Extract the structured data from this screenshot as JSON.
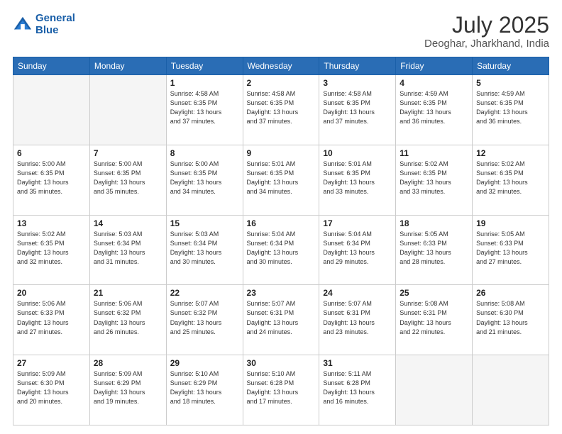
{
  "header": {
    "logo_line1": "General",
    "logo_line2": "Blue",
    "title": "July 2025",
    "subtitle": "Deoghar, Jharkhand, India"
  },
  "columns": [
    "Sunday",
    "Monday",
    "Tuesday",
    "Wednesday",
    "Thursday",
    "Friday",
    "Saturday"
  ],
  "weeks": [
    [
      {
        "day": "",
        "info": ""
      },
      {
        "day": "",
        "info": ""
      },
      {
        "day": "1",
        "info": "Sunrise: 4:58 AM\nSunset: 6:35 PM\nDaylight: 13 hours\nand 37 minutes."
      },
      {
        "day": "2",
        "info": "Sunrise: 4:58 AM\nSunset: 6:35 PM\nDaylight: 13 hours\nand 37 minutes."
      },
      {
        "day": "3",
        "info": "Sunrise: 4:58 AM\nSunset: 6:35 PM\nDaylight: 13 hours\nand 37 minutes."
      },
      {
        "day": "4",
        "info": "Sunrise: 4:59 AM\nSunset: 6:35 PM\nDaylight: 13 hours\nand 36 minutes."
      },
      {
        "day": "5",
        "info": "Sunrise: 4:59 AM\nSunset: 6:35 PM\nDaylight: 13 hours\nand 36 minutes."
      }
    ],
    [
      {
        "day": "6",
        "info": "Sunrise: 5:00 AM\nSunset: 6:35 PM\nDaylight: 13 hours\nand 35 minutes."
      },
      {
        "day": "7",
        "info": "Sunrise: 5:00 AM\nSunset: 6:35 PM\nDaylight: 13 hours\nand 35 minutes."
      },
      {
        "day": "8",
        "info": "Sunrise: 5:00 AM\nSunset: 6:35 PM\nDaylight: 13 hours\nand 34 minutes."
      },
      {
        "day": "9",
        "info": "Sunrise: 5:01 AM\nSunset: 6:35 PM\nDaylight: 13 hours\nand 34 minutes."
      },
      {
        "day": "10",
        "info": "Sunrise: 5:01 AM\nSunset: 6:35 PM\nDaylight: 13 hours\nand 33 minutes."
      },
      {
        "day": "11",
        "info": "Sunrise: 5:02 AM\nSunset: 6:35 PM\nDaylight: 13 hours\nand 33 minutes."
      },
      {
        "day": "12",
        "info": "Sunrise: 5:02 AM\nSunset: 6:35 PM\nDaylight: 13 hours\nand 32 minutes."
      }
    ],
    [
      {
        "day": "13",
        "info": "Sunrise: 5:02 AM\nSunset: 6:35 PM\nDaylight: 13 hours\nand 32 minutes."
      },
      {
        "day": "14",
        "info": "Sunrise: 5:03 AM\nSunset: 6:34 PM\nDaylight: 13 hours\nand 31 minutes."
      },
      {
        "day": "15",
        "info": "Sunrise: 5:03 AM\nSunset: 6:34 PM\nDaylight: 13 hours\nand 30 minutes."
      },
      {
        "day": "16",
        "info": "Sunrise: 5:04 AM\nSunset: 6:34 PM\nDaylight: 13 hours\nand 30 minutes."
      },
      {
        "day": "17",
        "info": "Sunrise: 5:04 AM\nSunset: 6:34 PM\nDaylight: 13 hours\nand 29 minutes."
      },
      {
        "day": "18",
        "info": "Sunrise: 5:05 AM\nSunset: 6:33 PM\nDaylight: 13 hours\nand 28 minutes."
      },
      {
        "day": "19",
        "info": "Sunrise: 5:05 AM\nSunset: 6:33 PM\nDaylight: 13 hours\nand 27 minutes."
      }
    ],
    [
      {
        "day": "20",
        "info": "Sunrise: 5:06 AM\nSunset: 6:33 PM\nDaylight: 13 hours\nand 27 minutes."
      },
      {
        "day": "21",
        "info": "Sunrise: 5:06 AM\nSunset: 6:32 PM\nDaylight: 13 hours\nand 26 minutes."
      },
      {
        "day": "22",
        "info": "Sunrise: 5:07 AM\nSunset: 6:32 PM\nDaylight: 13 hours\nand 25 minutes."
      },
      {
        "day": "23",
        "info": "Sunrise: 5:07 AM\nSunset: 6:31 PM\nDaylight: 13 hours\nand 24 minutes."
      },
      {
        "day": "24",
        "info": "Sunrise: 5:07 AM\nSunset: 6:31 PM\nDaylight: 13 hours\nand 23 minutes."
      },
      {
        "day": "25",
        "info": "Sunrise: 5:08 AM\nSunset: 6:31 PM\nDaylight: 13 hours\nand 22 minutes."
      },
      {
        "day": "26",
        "info": "Sunrise: 5:08 AM\nSunset: 6:30 PM\nDaylight: 13 hours\nand 21 minutes."
      }
    ],
    [
      {
        "day": "27",
        "info": "Sunrise: 5:09 AM\nSunset: 6:30 PM\nDaylight: 13 hours\nand 20 minutes."
      },
      {
        "day": "28",
        "info": "Sunrise: 5:09 AM\nSunset: 6:29 PM\nDaylight: 13 hours\nand 19 minutes."
      },
      {
        "day": "29",
        "info": "Sunrise: 5:10 AM\nSunset: 6:29 PM\nDaylight: 13 hours\nand 18 minutes."
      },
      {
        "day": "30",
        "info": "Sunrise: 5:10 AM\nSunset: 6:28 PM\nDaylight: 13 hours\nand 17 minutes."
      },
      {
        "day": "31",
        "info": "Sunrise: 5:11 AM\nSunset: 6:28 PM\nDaylight: 13 hours\nand 16 minutes."
      },
      {
        "day": "",
        "info": ""
      },
      {
        "day": "",
        "info": ""
      }
    ]
  ]
}
